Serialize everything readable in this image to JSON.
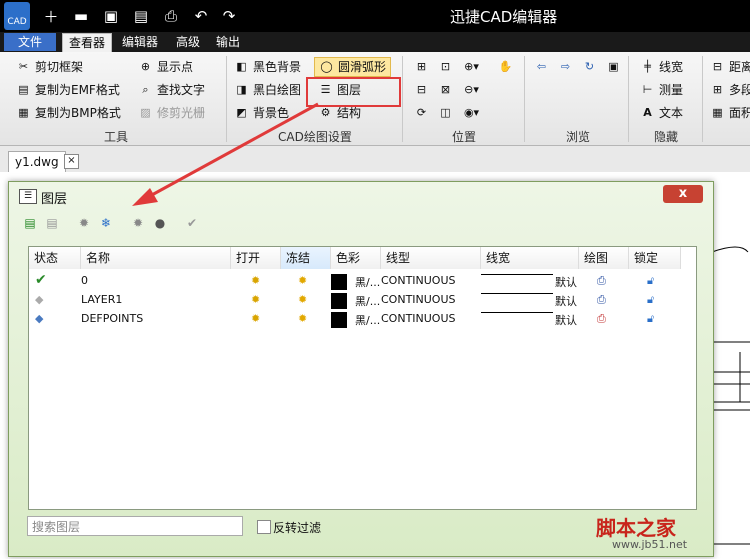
{
  "titlebar": {
    "app_title": "迅捷CAD编辑器",
    "logo": "CAD",
    "quick_icons": [
      "new-icon",
      "open-folder-icon",
      "save-icon",
      "save-as-icon",
      "print-icon",
      "undo-icon",
      "redo-icon"
    ]
  },
  "menubar": {
    "items": [
      {
        "label": "文件"
      },
      {
        "label": "查看器"
      },
      {
        "label": "编辑器"
      },
      {
        "label": "高级"
      },
      {
        "label": "输出"
      }
    ]
  },
  "ribbon": {
    "tools": {
      "label": "工具",
      "items": [
        "剪切框架",
        "显示点",
        "复制为EMF格式",
        "查找文字",
        "复制为BMP格式",
        "修剪光栅"
      ]
    },
    "cad": {
      "label": "CAD绘图设置",
      "items": [
        "黑色背景",
        "圆滑弧形",
        "黑白绘图",
        "图层",
        "背景色",
        "结构"
      ]
    },
    "position": {
      "label": "位置"
    },
    "browse": {
      "label": "浏览"
    },
    "hide": {
      "label": "隐藏",
      "items": [
        "线宽",
        "测量",
        "文本"
      ]
    },
    "right": {
      "items": [
        "距离",
        "多段",
        "面积"
      ]
    }
  },
  "doc_tab": {
    "label": "y1.dwg",
    "close": "×"
  },
  "dialog": {
    "title": "图层",
    "close": "x",
    "columns": [
      "状态",
      "名称",
      "打开",
      "冻结",
      "色彩",
      "线型",
      "线宽",
      "绘图",
      "锁定"
    ],
    "rows": [
      {
        "name": "0",
        "color": "黑/...",
        "linetype": "CONTINUOUS",
        "lineweight": "默认"
      },
      {
        "name": "LAYER1",
        "color": "黑/...",
        "linetype": "CONTINUOUS",
        "lineweight": "默认"
      },
      {
        "name": "DEFPOINTS",
        "color": "黑/...",
        "linetype": "CONTINUOUS",
        "lineweight": "默认"
      }
    ],
    "search_placeholder": "搜索图层",
    "invert_filter_label": "反转过滤"
  },
  "watermark": {
    "text": "脚本之家",
    "url": "www.jb51.net"
  },
  "colors": {
    "highlight": "#e03a3a",
    "dialog": "#d9ebc6",
    "titlebar": "#000000"
  }
}
